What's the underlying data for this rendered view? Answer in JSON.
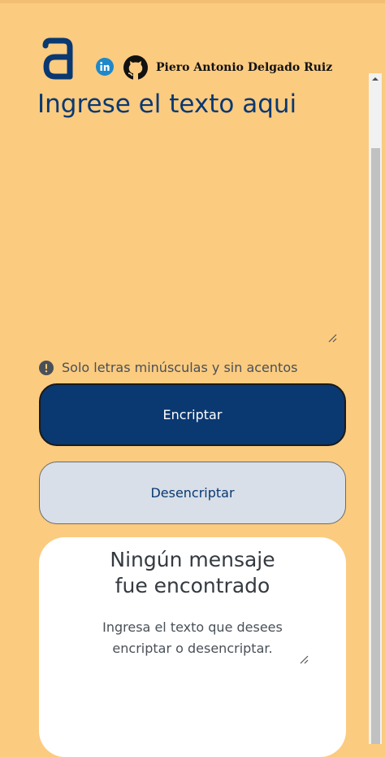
{
  "header": {
    "logo_icon": "alura-a-logo-icon",
    "linkedin_icon": "linkedin-icon",
    "github_icon": "github-icon",
    "author": "Piero Antonio Delgado Ruiz"
  },
  "input": {
    "placeholder": "Ingrese el texto aqui",
    "value": ""
  },
  "info": {
    "icon": "exclamation-circle-icon",
    "text": "Solo letras minúsculas y sin acentos"
  },
  "buttons": {
    "encrypt": "Encriptar",
    "decrypt": "Desencriptar"
  },
  "output": {
    "title_line1": "Ningún mensaje",
    "title_line2": "fue encontrado",
    "subtitle_line1": "Ingresa el texto que desees",
    "subtitle_line2": "encriptar o desencriptar."
  },
  "colors": {
    "background": "#FBCB80",
    "accent": "#0A3871",
    "secondary_button": "#D8DFE8",
    "card": "#FFFFFF"
  }
}
